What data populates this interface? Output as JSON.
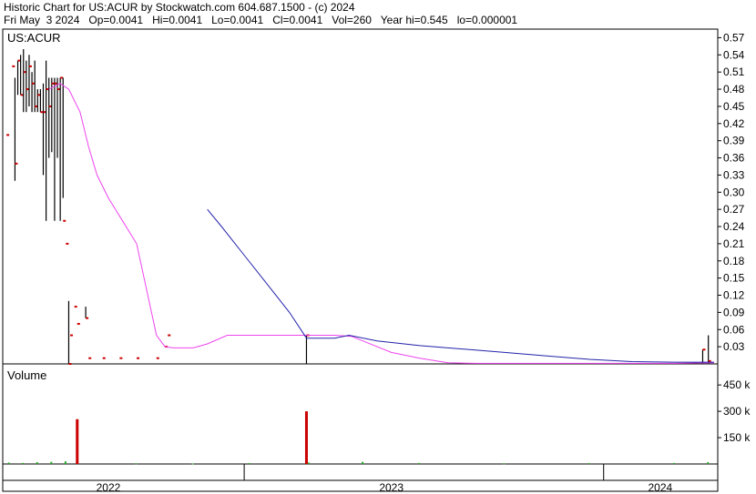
{
  "header": {
    "line1": "Historic Chart for US:ACUR by Stockwatch.com 604.687.1500 - (c) 2024",
    "line2": "Fri May  3 2024   Op=0.0041   Hi=0.0041   Lo=0.0041   Cl=0.0041   Vol=260   Year hi=0.545   lo=0.000001"
  },
  "colors": {
    "background": "#ffffff",
    "price_bar": "#000000",
    "close_tick": "#cc0000",
    "ma_short": "#ee44ee",
    "ma_long": "#2222aa",
    "volume_bar": "#cc0000",
    "volume_small": "#22aa22",
    "grid": "#d9d9d9"
  },
  "chart_data": [
    {
      "type": "line",
      "panel": "price",
      "label": "US:ACUR",
      "ylim": [
        0,
        0.585
      ],
      "y_ticks": [
        "0.57",
        "0.54",
        "0.51",
        "0.48",
        "0.45",
        "0.42",
        "0.39",
        "0.36",
        "0.33",
        "0.30",
        "0.27",
        "0.24",
        "0.21",
        "0.18",
        "0.15",
        "0.12",
        "0.09",
        "0.06",
        "0.03"
      ],
      "y_tick_values": [
        0.57,
        0.54,
        0.51,
        0.48,
        0.45,
        0.42,
        0.39,
        0.36,
        0.33,
        0.3,
        0.27,
        0.24,
        0.21,
        0.18,
        0.15,
        0.12,
        0.09,
        0.06,
        0.03
      ],
      "x_labels": [
        "2022",
        "2023",
        "2024"
      ],
      "x_range": [
        "2021-11",
        "2024-05"
      ],
      "price_bars": [
        {
          "t": 2021.84,
          "hi": 0.4,
          "lo": 0.4,
          "cl": 0.4
        },
        {
          "t": 2021.86,
          "hi": 0.52,
          "lo": 0.52,
          "cl": 0.52
        },
        {
          "t": 2021.87,
          "hi": 0.5,
          "lo": 0.32,
          "cl": 0.35
        },
        {
          "t": 2021.88,
          "hi": 0.53,
          "lo": 0.47,
          "cl": 0.53
        },
        {
          "t": 2021.89,
          "hi": 0.54,
          "lo": 0.47,
          "cl": 0.47
        },
        {
          "t": 2021.9,
          "hi": 0.55,
          "lo": 0.44,
          "cl": 0.51
        },
        {
          "t": 2021.91,
          "hi": 0.53,
          "lo": 0.44,
          "cl": 0.48
        },
        {
          "t": 2021.92,
          "hi": 0.54,
          "lo": 0.45,
          "cl": 0.52
        },
        {
          "t": 2021.93,
          "hi": 0.51,
          "lo": 0.44,
          "cl": 0.49
        },
        {
          "t": 2021.94,
          "hi": 0.53,
          "lo": 0.44,
          "cl": 0.45
        },
        {
          "t": 2021.95,
          "hi": 0.48,
          "lo": 0.44,
          "cl": 0.47
        },
        {
          "t": 2021.96,
          "hi": 0.48,
          "lo": 0.44,
          "cl": 0.44
        },
        {
          "t": 2021.97,
          "hi": 0.49,
          "lo": 0.33,
          "cl": 0.44
        },
        {
          "t": 2021.98,
          "hi": 0.53,
          "lo": 0.25,
          "cl": 0.48
        },
        {
          "t": 2021.99,
          "hi": 0.5,
          "lo": 0.36,
          "cl": 0.45
        },
        {
          "t": 2022.0,
          "hi": 0.5,
          "lo": 0.37,
          "cl": 0.49
        },
        {
          "t": 2022.01,
          "hi": 0.5,
          "lo": 0.25,
          "cl": 0.49
        },
        {
          "t": 2022.02,
          "hi": 0.5,
          "lo": 0.36,
          "cl": 0.48
        },
        {
          "t": 2022.03,
          "hi": 0.5,
          "lo": 0.25,
          "cl": 0.5
        },
        {
          "t": 2022.04,
          "hi": 0.5,
          "lo": 0.29,
          "cl": 0.25
        },
        {
          "t": 2022.05,
          "hi": 0.21,
          "lo": 0.21,
          "cl": 0.21
        },
        {
          "t": 2022.06,
          "hi": 0.11,
          "lo": 0.0,
          "cl": 0.0
        },
        {
          "t": 2022.065,
          "hi": 0.05,
          "lo": 0.05,
          "cl": 0.05
        },
        {
          "t": 2022.08,
          "hi": 0.1,
          "lo": 0.1,
          "cl": 0.1
        },
        {
          "t": 2022.09,
          "hi": 0.07,
          "lo": 0.07,
          "cl": 0.07
        },
        {
          "t": 2022.12,
          "hi": 0.1,
          "lo": 0.08,
          "cl": 0.08
        },
        {
          "t": 2022.13,
          "hi": 0.01,
          "lo": 0.01,
          "cl": 0.01
        },
        {
          "t": 2022.18,
          "hi": 0.01,
          "lo": 0.01,
          "cl": 0.01
        },
        {
          "t": 2022.24,
          "hi": 0.01,
          "lo": 0.01,
          "cl": 0.01
        },
        {
          "t": 2022.3,
          "hi": 0.01,
          "lo": 0.01,
          "cl": 0.01
        },
        {
          "t": 2022.37,
          "hi": 0.01,
          "lo": 0.01,
          "cl": 0.01
        },
        {
          "t": 2022.4,
          "hi": 0.03,
          "lo": 0.03,
          "cl": 0.03
        },
        {
          "t": 2022.41,
          "hi": 0.05,
          "lo": 0.05,
          "cl": 0.05
        },
        {
          "t": 2022.9,
          "hi": 0.05,
          "lo": 0.0,
          "cl": 0.05
        },
        {
          "t": 2024.3,
          "hi": 0.025,
          "lo": 0.0,
          "cl": 0.025
        },
        {
          "t": 2024.32,
          "hi": 0.05,
          "lo": 0.0,
          "cl": 0.005
        }
      ],
      "series": [
        {
          "name": "",
          "role": "ma_short",
          "x": [
            2021.99,
            2022.03,
            2022.06,
            2022.1,
            2022.13,
            2022.16,
            2022.2,
            2022.25,
            2022.3,
            2022.37,
            2022.4,
            2022.43,
            2022.5,
            2022.55,
            2022.62,
            2022.7,
            2022.8,
            2022.9,
            2023.0,
            2023.06,
            2023.1,
            2023.2,
            2023.3,
            2023.4,
            2023.5,
            2023.6,
            2023.7,
            2023.8,
            2023.9,
            2024.0,
            2024.1,
            2024.2,
            2024.34
          ],
          "y": [
            0.48,
            0.49,
            0.48,
            0.44,
            0.38,
            0.33,
            0.29,
            0.25,
            0.21,
            0.05,
            0.03,
            0.028,
            0.028,
            0.035,
            0.05,
            0.05,
            0.05,
            0.05,
            0.05,
            0.048,
            0.04,
            0.02,
            0.01,
            0.002,
            0.001,
            0.001,
            0.001,
            0.001,
            0.001,
            0.001,
            0.001,
            0.001,
            0.002
          ]
        },
        {
          "name": "",
          "role": "ma_long",
          "x": [
            2022.55,
            2022.6,
            2022.68,
            2022.76,
            2022.84,
            2022.9,
            2023.0,
            2023.05,
            2023.15,
            2023.3,
            2023.45,
            2023.6,
            2023.75,
            2023.9,
            2024.05,
            2024.2,
            2024.34
          ],
          "y": [
            0.27,
            0.24,
            0.19,
            0.14,
            0.09,
            0.045,
            0.045,
            0.05,
            0.04,
            0.032,
            0.026,
            0.02,
            0.014,
            0.008,
            0.004,
            0.003,
            0.003
          ]
        }
      ]
    },
    {
      "type": "bar",
      "panel": "volume",
      "label": "Volume",
      "ylim": [
        0,
        570
      ],
      "y_ticks": [
        "450 k",
        "300 k",
        "150 k"
      ],
      "y_tick_values": [
        450,
        300,
        150
      ],
      "unit": "k",
      "x": [
        2021.85,
        2021.9,
        2021.95,
        2022.0,
        2022.05,
        2022.09,
        2022.3,
        2022.5,
        2022.7,
        2022.9,
        2022.91,
        2023.1,
        2023.3,
        2023.6,
        2023.9,
        2024.2,
        2024.32
      ],
      "values": [
        8,
        6,
        10,
        12,
        15,
        255,
        4,
        3,
        5,
        300,
        8,
        12,
        6,
        4,
        5,
        6,
        10
      ]
    }
  ]
}
